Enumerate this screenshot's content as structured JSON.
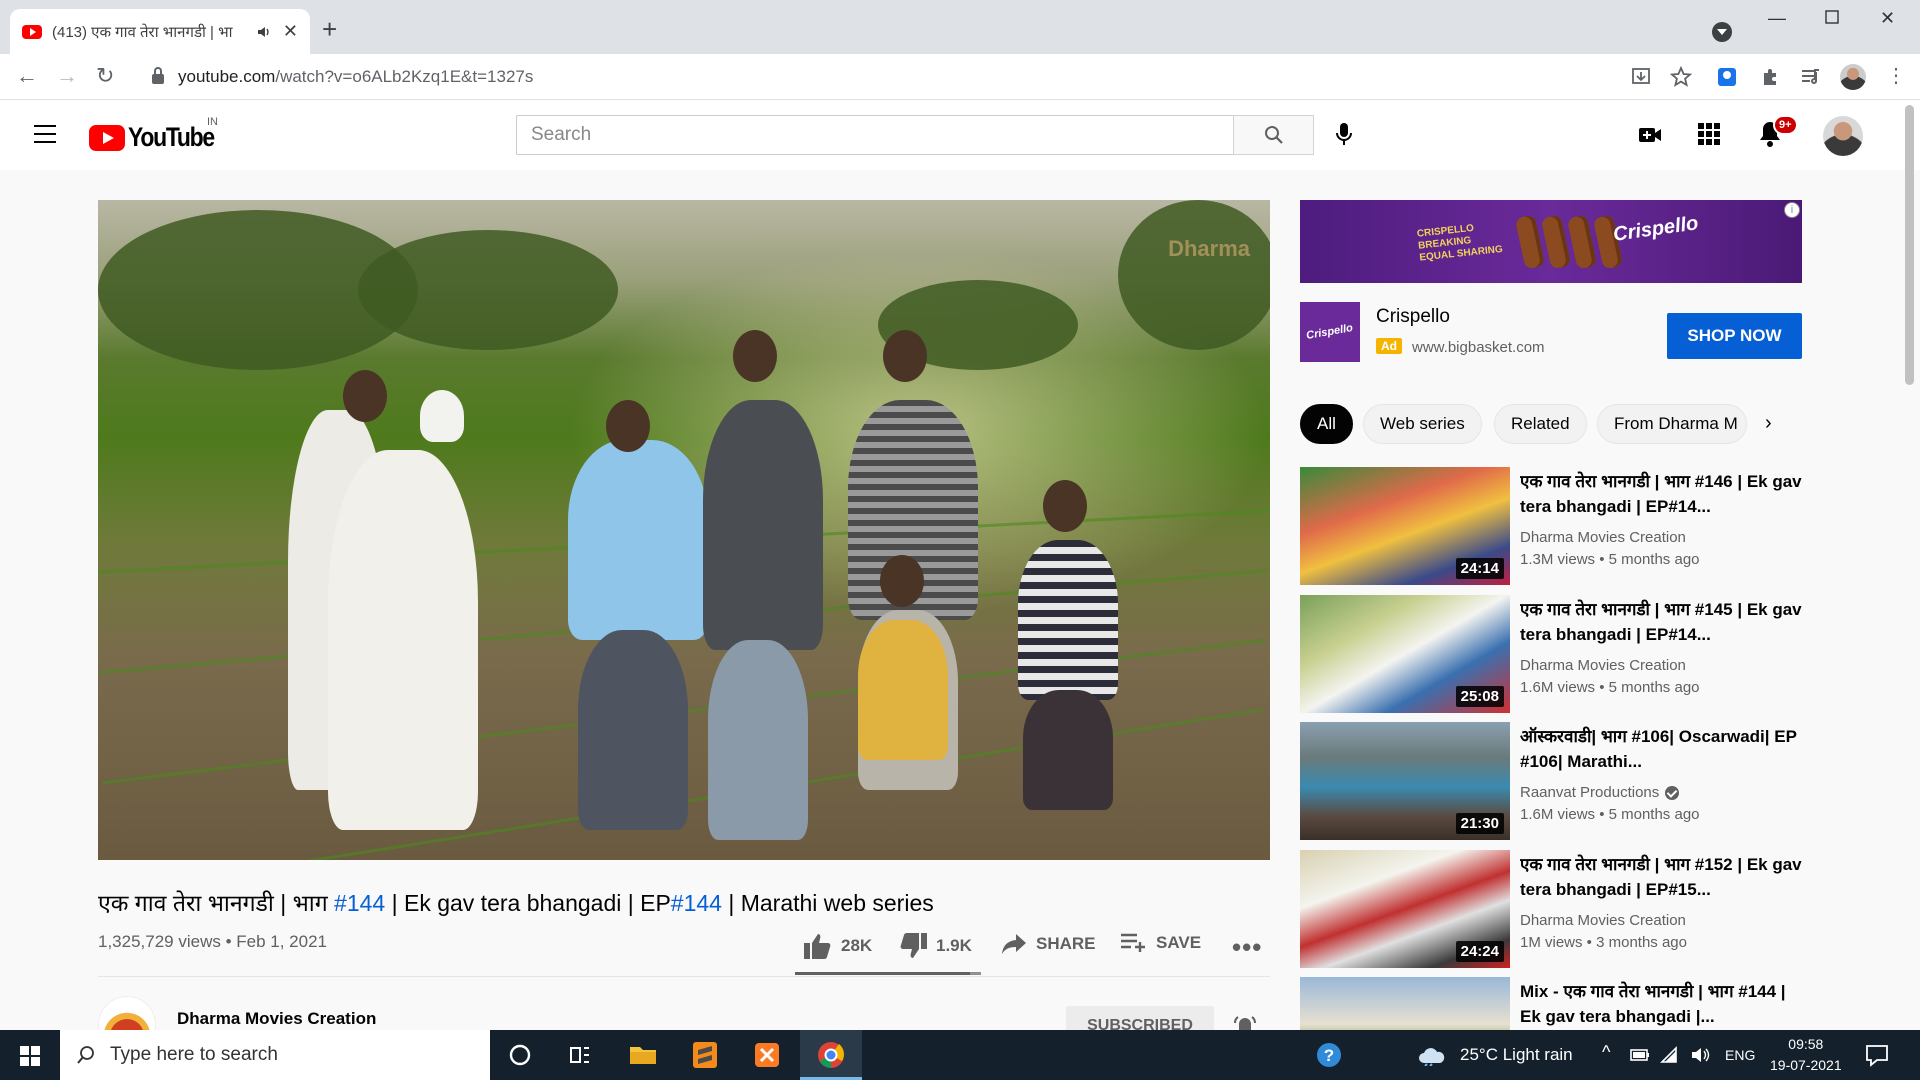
{
  "browser": {
    "tab_title": "(413) एक गाव तेरा भानगडी | भा",
    "url_host": "youtube.com",
    "url_path": "/watch?v=o6ALb2Kzq1E&t=1327s"
  },
  "header": {
    "logo_text": "YouTube",
    "country": "IN",
    "search_placeholder": "Search",
    "notification_count": "9+"
  },
  "video": {
    "title_prefix": "एक गाव तेरा भानगडी | भाग ",
    "title_tag1": "#144",
    "title_mid": " | Ek gav tera bhangadi | EP",
    "title_tag2": "#144",
    "title_suffix": " | Marathi web series",
    "meta": "1,325,729 views • Feb 1, 2021",
    "likes": "28K",
    "dislikes": "1.9K",
    "share_label": "SHARE",
    "save_label": "SAVE",
    "like_ratio": 0.94,
    "watermark": "Dharma",
    "channel_name": "Dharma Movies Creation",
    "subscribed_label": "SUBSCRIBED"
  },
  "ad": {
    "banner_tag": "CRISPELLO BREAKING EQUAL SHARING",
    "banner_brand": "Crispello",
    "thumb_text": "Crispello",
    "name": "Crispello",
    "badge": "Ad",
    "url": "www.bigbasket.com",
    "cta": "SHOP NOW"
  },
  "chips": [
    "All",
    "Web series",
    "Related",
    "From Dharma M"
  ],
  "recommendations": [
    {
      "title": "एक गाव तेरा भानगडी | भाग #146 | Ek gav tera bhangadi | EP#14...",
      "channel": "Dharma Movies Creation",
      "stats": "1.3M views • 5 months ago",
      "duration": "24:14",
      "verified": false
    },
    {
      "title": "एक गाव तेरा भानगडी | भाग #145 | Ek gav tera bhangadi | EP#14...",
      "channel": "Dharma Movies Creation",
      "stats": "1.6M views • 5 months ago",
      "duration": "25:08",
      "verified": false
    },
    {
      "title": "ऑस्करवाडी| भाग #106| Oscarwadi| EP #106| Marathi...",
      "channel": "Raanvat Productions",
      "stats": "1.6M views • 5 months ago",
      "duration": "21:30",
      "verified": true
    },
    {
      "title": "एक गाव तेरा भानगडी | भाग #152 | Ek gav tera bhangadi | EP#15...",
      "channel": "Dharma Movies Creation",
      "stats": "1M views • 3 months ago",
      "duration": "24:24",
      "verified": false
    },
    {
      "title": "Mix - एक गाव तेरा भानगडी | भाग #144 | Ek gav tera bhangadi |...",
      "channel": "",
      "stats": "",
      "duration": "",
      "verified": false
    }
  ],
  "taskbar": {
    "search_placeholder": "Type here to search",
    "weather": "25°C  Light rain",
    "lang": "ENG",
    "time": "09:58",
    "date": "19-07-2021"
  }
}
